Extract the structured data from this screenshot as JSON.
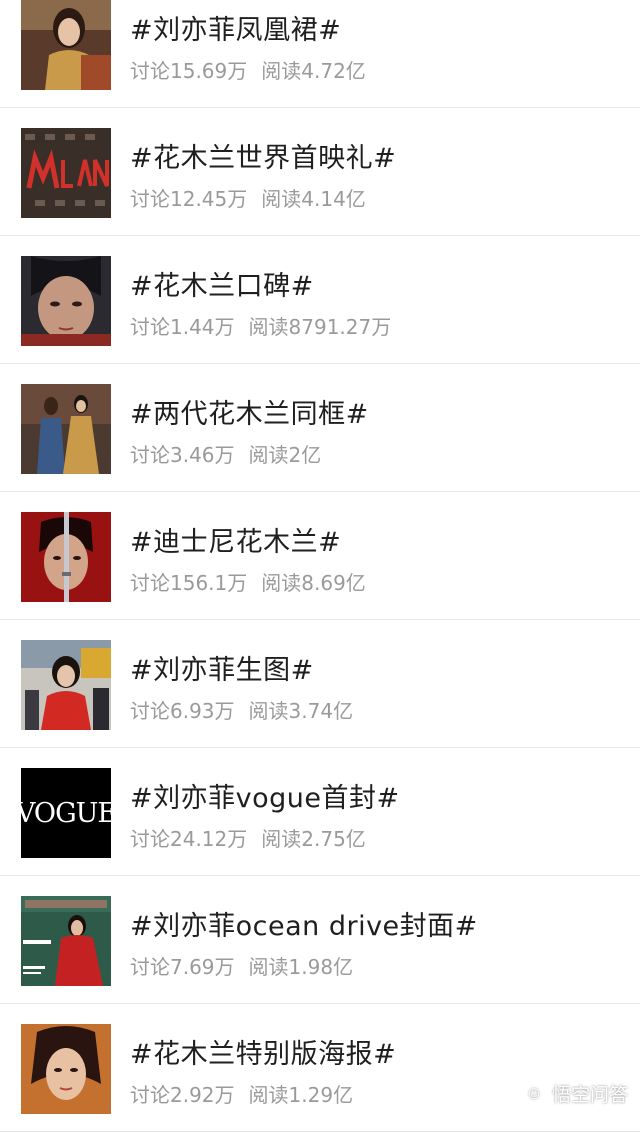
{
  "topics": [
    {
      "title": "#刘亦菲凤凰裙#",
      "discuss_label": "讨论",
      "discuss": "15.69万",
      "read_label": "阅读",
      "read": "4.72亿",
      "thumb": "red-carpet-gold-dress-photo"
    },
    {
      "title": "#花木兰世界首映礼#",
      "discuss_label": "讨论",
      "discuss": "12.45万",
      "read_label": "阅读",
      "read": "4.14亿",
      "thumb": "mulan-premiere-backdrop-photo"
    },
    {
      "title": "#花木兰口碑#",
      "discuss_label": "讨论",
      "discuss": "1.44万",
      "read_label": "阅读",
      "read": "8791.27万",
      "thumb": "mulan-closeup-photo"
    },
    {
      "title": "#两代花木兰同框#",
      "discuss_label": "讨论",
      "discuss": "3.46万",
      "read_label": "阅读",
      "read": "2亿",
      "thumb": "two-actresses-photo"
    },
    {
      "title": "#迪士尼花木兰#",
      "discuss_label": "讨论",
      "discuss": "156.1万",
      "read_label": "阅读",
      "read": "8.69亿",
      "thumb": "mulan-sword-poster"
    },
    {
      "title": "#刘亦菲生图#",
      "discuss_label": "讨论",
      "discuss": "6.93万",
      "read_label": "阅读",
      "read": "3.74亿",
      "thumb": "event-candid-photo"
    },
    {
      "title": "#刘亦菲vogue首封#",
      "discuss_label": "讨论",
      "discuss": "24.12万",
      "read_label": "阅读",
      "read": "2.75亿",
      "thumb": "vogue-logo",
      "thumb_text": "VOGUE"
    },
    {
      "title": "#刘亦菲ocean drive封面#",
      "discuss_label": "讨论",
      "discuss": "7.69万",
      "read_label": "阅读",
      "read": "1.98亿",
      "thumb": "ocean-drive-cover"
    },
    {
      "title": "#花木兰特别版海报#",
      "discuss_label": "讨论",
      "discuss": "2.92万",
      "read_label": "阅读",
      "read": "1.29亿",
      "thumb": "special-poster-photo"
    }
  ],
  "watermark": {
    "text": "悟空问答",
    "icon": "wukong-logo-icon"
  }
}
